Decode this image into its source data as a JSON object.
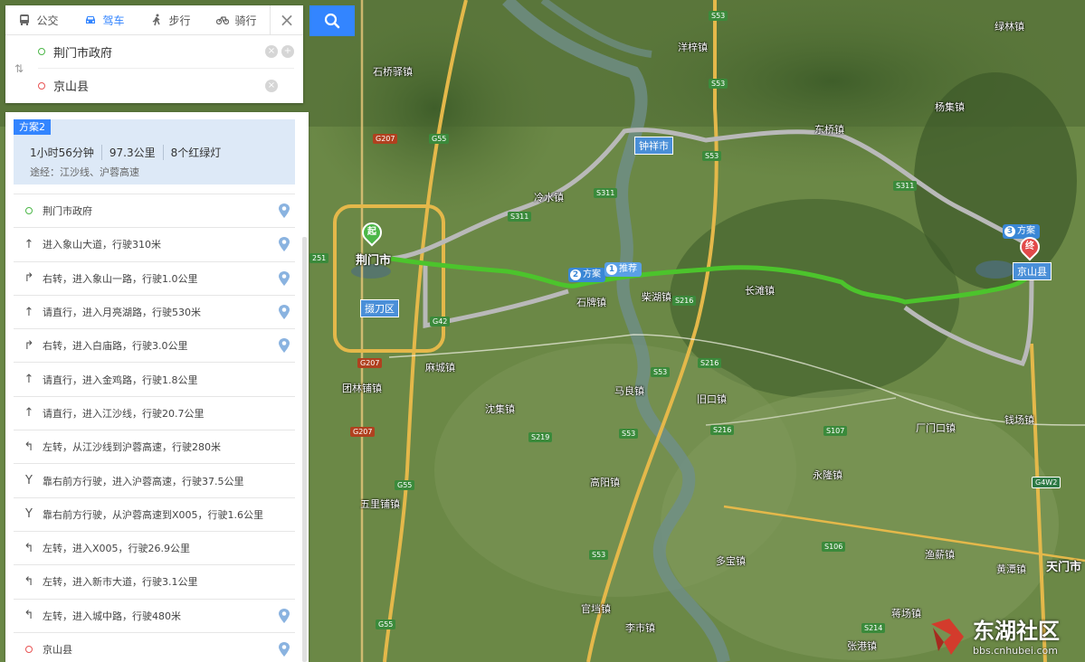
{
  "tabs": [
    {
      "label": "公交",
      "icon": "bus-icon"
    },
    {
      "label": "驾车",
      "icon": "car-icon",
      "active": true
    },
    {
      "label": "步行",
      "icon": "walk-icon"
    },
    {
      "label": "骑行",
      "icon": "bike-icon"
    }
  ],
  "search": {
    "from": "荆门市政府",
    "to": "京山县",
    "close": "×",
    "swap": "⇅"
  },
  "plan": {
    "tag": "方案2",
    "duration": "1小时56分钟",
    "distance": "97.3公里",
    "lights": "8个红绿灯",
    "via": "途经：江沙线、沪蓉高速"
  },
  "steps": [
    {
      "icon": "start-dot-icon",
      "text": "荆门市政府",
      "pin": true
    },
    {
      "icon": "arrow-up-icon",
      "text": "进入象山大道，行驶310米",
      "pin": true
    },
    {
      "icon": "turn-right-icon",
      "text": "右转，进入象山一路，行驶1.0公里",
      "pin": true
    },
    {
      "icon": "arrow-up-icon",
      "text": "请直行，进入月亮湖路，行驶530米",
      "pin": true
    },
    {
      "icon": "turn-right-icon",
      "text": "右转，进入白庙路，行驶3.0公里",
      "pin": true
    },
    {
      "icon": "arrow-up-icon",
      "text": "请直行，进入金鸡路，行驶1.8公里",
      "pin": false
    },
    {
      "icon": "arrow-up-icon",
      "text": "请直行，进入江沙线，行驶20.7公里",
      "pin": false
    },
    {
      "icon": "turn-left-icon",
      "text": "左转，从江沙线到沪蓉高速，行驶280米",
      "pin": false
    },
    {
      "icon": "keep-right-icon",
      "text": "靠右前方行驶，进入沪蓉高速，行驶37.5公里",
      "pin": false
    },
    {
      "icon": "keep-right-icon",
      "text": "靠右前方行驶，从沪蓉高速到X005，行驶1.6公里",
      "pin": false
    },
    {
      "icon": "turn-left-icon",
      "text": "左转，进入X005，行驶26.9公里",
      "pin": false
    },
    {
      "icon": "turn-left-icon",
      "text": "左转，进入新市大道，行驶3.1公里",
      "pin": false
    },
    {
      "icon": "turn-left-icon",
      "text": "左转，进入城中路，行驶480米",
      "pin": true
    },
    {
      "icon": "end-dot-icon",
      "text": "京山县",
      "pin": true
    }
  ],
  "map": {
    "start_marker": "起",
    "end_marker": "终",
    "route_badges": [
      {
        "num": "2",
        "label": "方案"
      },
      {
        "num": "1",
        "label": "推荐"
      },
      {
        "num": "3",
        "label": "方案"
      }
    ],
    "city_boxes": [
      "钟祥市",
      "京山县",
      "掇刀区"
    ],
    "places": [
      {
        "name": "石桥驿镇"
      },
      {
        "name": "洋梓镇"
      },
      {
        "name": "绿林镇"
      },
      {
        "name": "杨集镇"
      },
      {
        "name": "东桥镇"
      },
      {
        "name": "冷水镇"
      },
      {
        "name": "荆门市",
        "city": true
      },
      {
        "name": "石牌镇"
      },
      {
        "name": "柴湖镇"
      },
      {
        "name": "长滩镇"
      },
      {
        "name": "麻城镇"
      },
      {
        "name": "团林铺镇"
      },
      {
        "name": "沈集镇"
      },
      {
        "name": "马良镇"
      },
      {
        "name": "旧口镇"
      },
      {
        "name": "厂门口镇"
      },
      {
        "name": "钱场镇"
      },
      {
        "name": "永隆镇"
      },
      {
        "name": "五里铺镇"
      },
      {
        "name": "高阳镇"
      },
      {
        "name": "多宝镇"
      },
      {
        "name": "渔薪镇"
      },
      {
        "name": "天门市",
        "city": true
      },
      {
        "name": "黄潭镇"
      },
      {
        "name": "官垱镇"
      },
      {
        "name": "李市镇"
      },
      {
        "name": "蒋场镇"
      },
      {
        "name": "张港镇"
      }
    ],
    "shields": [
      {
        "code": "S53",
        "type": "s"
      },
      {
        "code": "S53",
        "type": "s"
      },
      {
        "code": "S53",
        "type": "s"
      },
      {
        "code": "S53",
        "type": "s"
      },
      {
        "code": "S53",
        "type": "s"
      },
      {
        "code": "S53",
        "type": "s"
      },
      {
        "code": "G207",
        "type": "g"
      },
      {
        "code": "G207",
        "type": "g"
      },
      {
        "code": "G207",
        "type": "g"
      },
      {
        "code": "G55",
        "type": "s"
      },
      {
        "code": "G55",
        "type": "s"
      },
      {
        "code": "G55",
        "type": "s"
      },
      {
        "code": "S311",
        "type": "s"
      },
      {
        "code": "S311",
        "type": "s"
      },
      {
        "code": "S311",
        "type": "s"
      },
      {
        "code": "S216",
        "type": "s"
      },
      {
        "code": "S216",
        "type": "s"
      },
      {
        "code": "S216",
        "type": "s"
      },
      {
        "code": "S219",
        "type": "s"
      },
      {
        "code": "S107",
        "type": "s"
      },
      {
        "code": "S106",
        "type": "s"
      },
      {
        "code": "S214",
        "type": "s"
      },
      {
        "code": "G42",
        "type": "s"
      },
      {
        "code": "G4W2",
        "type": "e"
      },
      {
        "code": "251",
        "type": "s"
      }
    ]
  },
  "watermark": {
    "title": "东湖社区",
    "url": "bbs.cnhubei.com"
  },
  "colors": {
    "accent": "#3385ff",
    "route_main": "#4cc42c",
    "route_alt": "#b9b9b9",
    "start": "#4cb748",
    "end": "#e24a4a"
  }
}
